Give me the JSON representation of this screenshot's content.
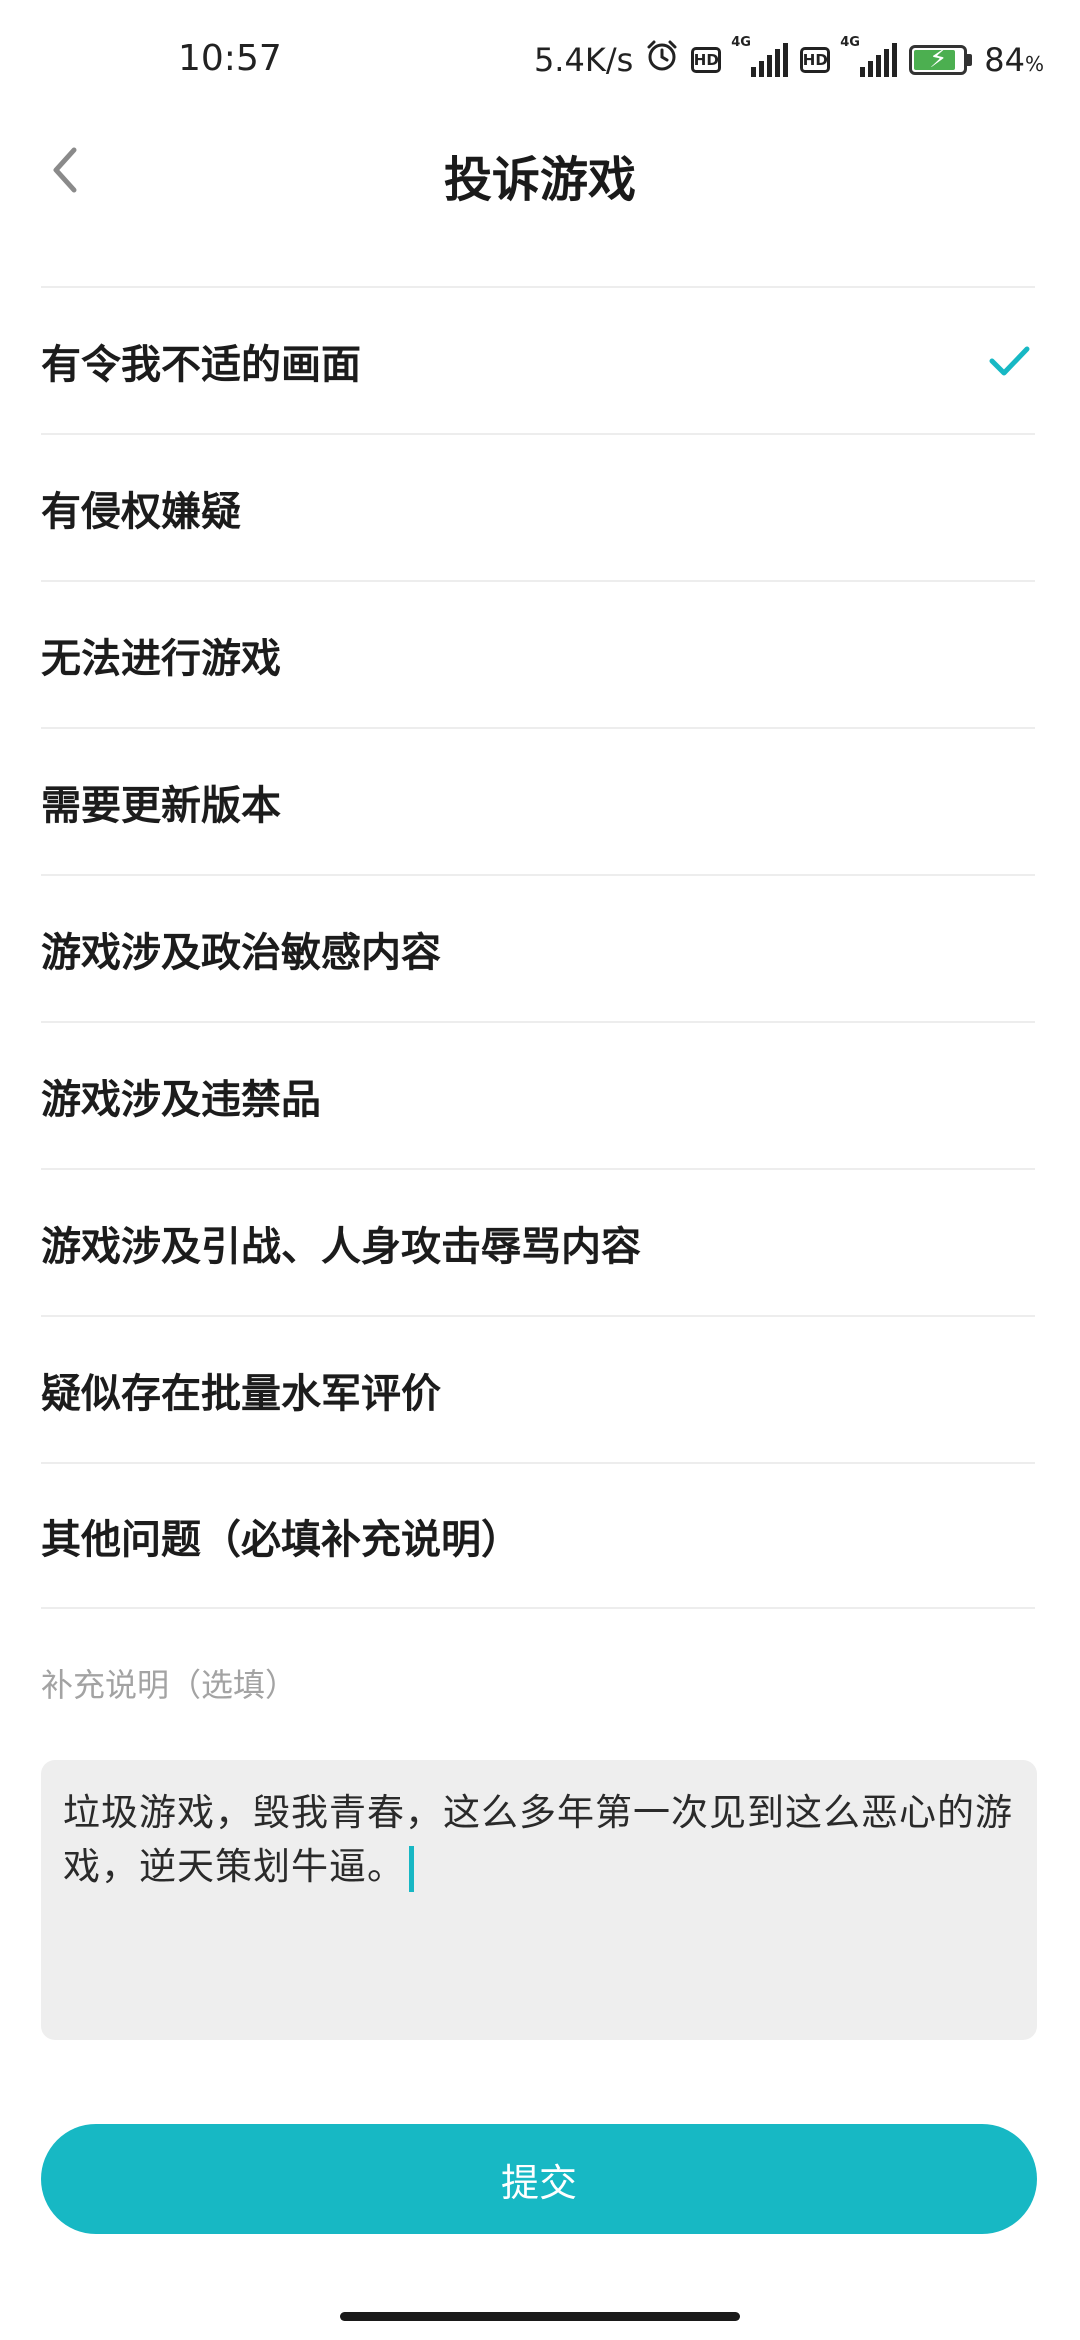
{
  "status_bar": {
    "time": "10:57",
    "net_speed": "5.4K/s",
    "hd_label": "HD",
    "net_type": "4G",
    "battery_percent": "84",
    "battery_unit": "%",
    "battery_level": 0.84,
    "icons": [
      "alarm-icon",
      "hd-icon",
      "signal-icon",
      "hd-icon",
      "signal-icon",
      "battery-charging-icon"
    ]
  },
  "header": {
    "title": "投诉游戏",
    "back_icon": "chevron-left-icon"
  },
  "reasons": [
    {
      "label": "有令我不适的画面",
      "selected": true
    },
    {
      "label": "有侵权嫌疑",
      "selected": false
    },
    {
      "label": "无法进行游戏",
      "selected": false
    },
    {
      "label": "需要更新版本",
      "selected": false
    },
    {
      "label": "游戏涉及政治敏感内容",
      "selected": false
    },
    {
      "label": "游戏涉及违禁品",
      "selected": false
    },
    {
      "label": "游戏涉及引战、人身攻击辱骂内容",
      "selected": false
    },
    {
      "label": "疑似存在批量水军评价",
      "selected": false
    },
    {
      "label": "其他问题（必填补充说明）",
      "selected": false
    }
  ],
  "supplement": {
    "label": "补充说明（选填）",
    "value": "垃圾游戏，毁我青春，这么多年第一次见到这么恶心的游戏，逆天策划牛逼。"
  },
  "submit_label": "提交",
  "colors": {
    "accent": "#17b8c4",
    "input_bg": "#eeeeee",
    "divider": "#ededed"
  }
}
